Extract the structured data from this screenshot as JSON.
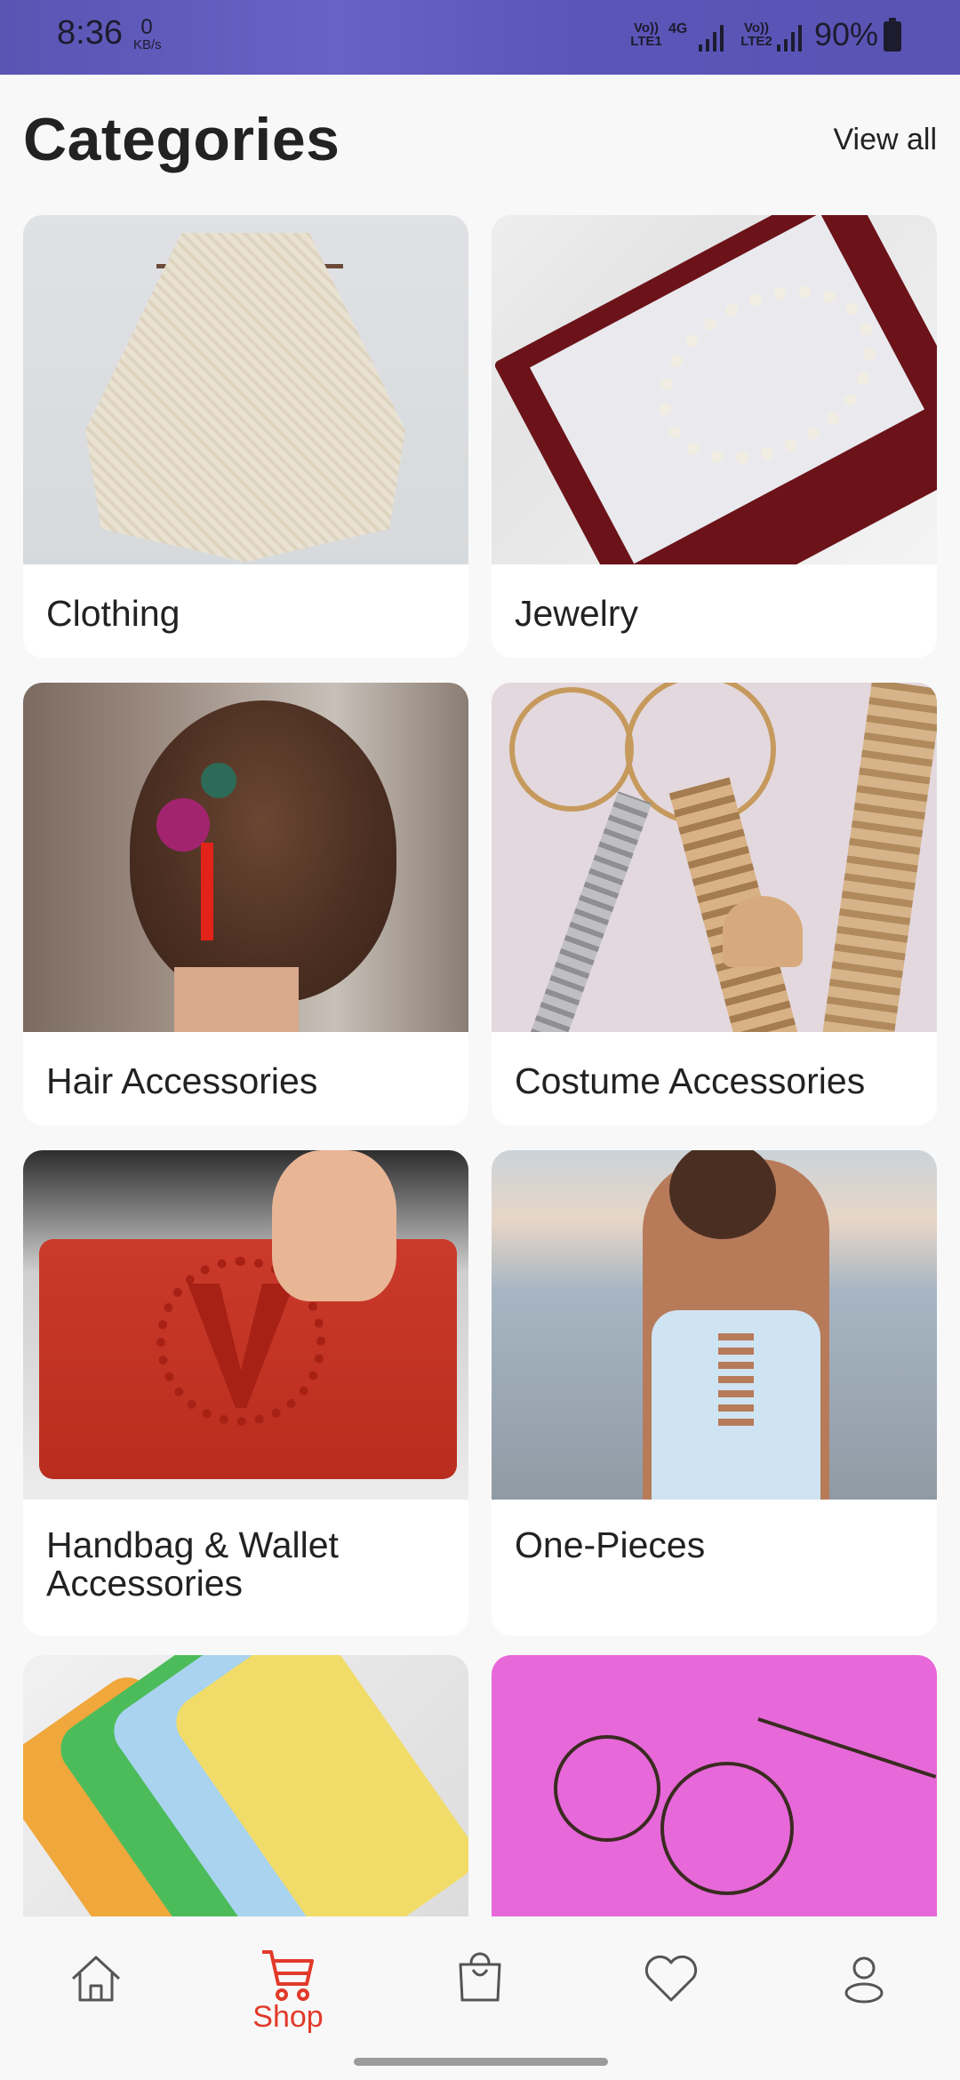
{
  "status_bar": {
    "time": "8:36",
    "speed_value": "0",
    "speed_unit": "KB/s",
    "sim1_label": "Vo)) LTE1",
    "network_type": "4G",
    "sim2_label": "Vo)) LTE2",
    "battery_percent": "90%"
  },
  "header": {
    "title": "Categories",
    "view_all_label": "View all"
  },
  "categories": [
    {
      "label": "Clothing",
      "image": "knit-sweater-on-hanger"
    },
    {
      "label": "Jewelry",
      "image": "pearl-necklace-in-box"
    },
    {
      "label": "Hair Accessories",
      "image": "braided-bun-with-hairpins"
    },
    {
      "label": "Costume Accessories",
      "image": "assorted-gold-and-silver-jewelry"
    },
    {
      "label": "Handbag & Wallet Accessories",
      "image": "red-clutch-handbag"
    },
    {
      "label": "One-Pieces",
      "image": "woman-in-swimsuit-on-beach"
    },
    {
      "label": "",
      "image": "stack-of-fabric-face-masks"
    },
    {
      "label": "",
      "image": "eyeglasses-on-pink-background"
    }
  ],
  "bottom_nav": {
    "items": [
      {
        "name": "home",
        "icon": "home-icon",
        "label": ""
      },
      {
        "name": "shop",
        "icon": "cart-icon",
        "label": "Shop",
        "active": true
      },
      {
        "name": "bag",
        "icon": "shopping-bag-icon",
        "label": ""
      },
      {
        "name": "favorites",
        "icon": "heart-icon",
        "label": ""
      },
      {
        "name": "profile",
        "icon": "user-icon",
        "label": ""
      }
    ],
    "active_color": "#e23a2a",
    "inactive_color": "#555555"
  }
}
